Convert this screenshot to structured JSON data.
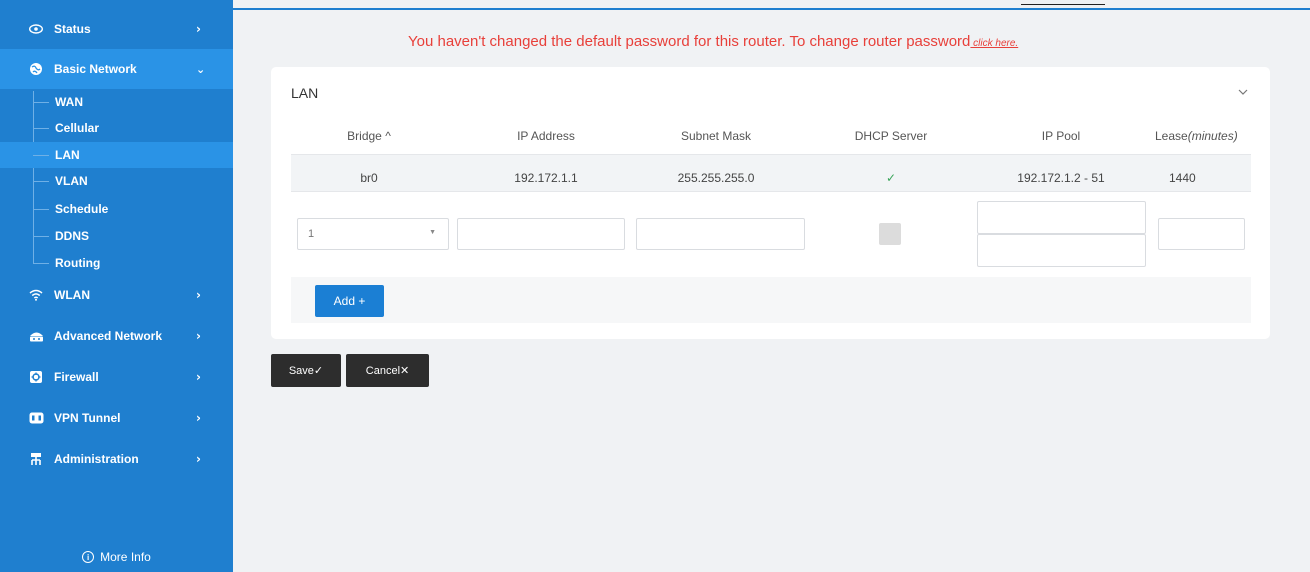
{
  "sidebar": {
    "items": [
      {
        "label": "Status",
        "icon": "eye-icon",
        "chevron": "›"
      },
      {
        "label": "Basic Network",
        "icon": "globe-icon",
        "chevron": "⌄"
      },
      {
        "label": "WLAN",
        "icon": "wifi-icon",
        "chevron": "›"
      },
      {
        "label": "Advanced Network",
        "icon": "network-icon",
        "chevron": "›"
      },
      {
        "label": "Firewall",
        "icon": "firewall-icon",
        "chevron": "›"
      },
      {
        "label": "VPN Tunnel",
        "icon": "vpn-icon",
        "chevron": "›"
      },
      {
        "label": "Administration",
        "icon": "admin-icon",
        "chevron": "›"
      }
    ],
    "sub_items": [
      {
        "label": "WAN"
      },
      {
        "label": "Cellular"
      },
      {
        "label": "LAN"
      },
      {
        "label": "VLAN"
      },
      {
        "label": "Schedule"
      },
      {
        "label": "DDNS"
      },
      {
        "label": "Routing"
      }
    ],
    "more_info": "More Info"
  },
  "warning": {
    "text": "You haven't changed the default password for this router. To change router password",
    "link": " click here."
  },
  "lan": {
    "title": "LAN",
    "headers": {
      "bridge": "Bridge ^",
      "ip": "IP Address",
      "mask": "Subnet Mask",
      "dhcp": "DHCP Server",
      "pool": "IP Pool",
      "lease_prefix": "Lease",
      "lease_unit": "(minutes)"
    },
    "row": {
      "bridge": "br0",
      "ip": "192.172.1.1",
      "mask": "255.255.255.0",
      "dhcp": "✓",
      "pool": "192.172.1.2 - 51",
      "lease": "1440"
    },
    "new_row": {
      "bridge_select": "1"
    },
    "add_label": "Add +"
  },
  "actions": {
    "save": "Save✓",
    "cancel": "Cancel✕"
  },
  "colors": {
    "sidebar": "#1f7fcf",
    "active": "#2a93e6",
    "warning": "#e8403a",
    "primary_button": "#1b7fd4",
    "dark_button": "#2d2d2d",
    "check": "#3aa55a"
  }
}
